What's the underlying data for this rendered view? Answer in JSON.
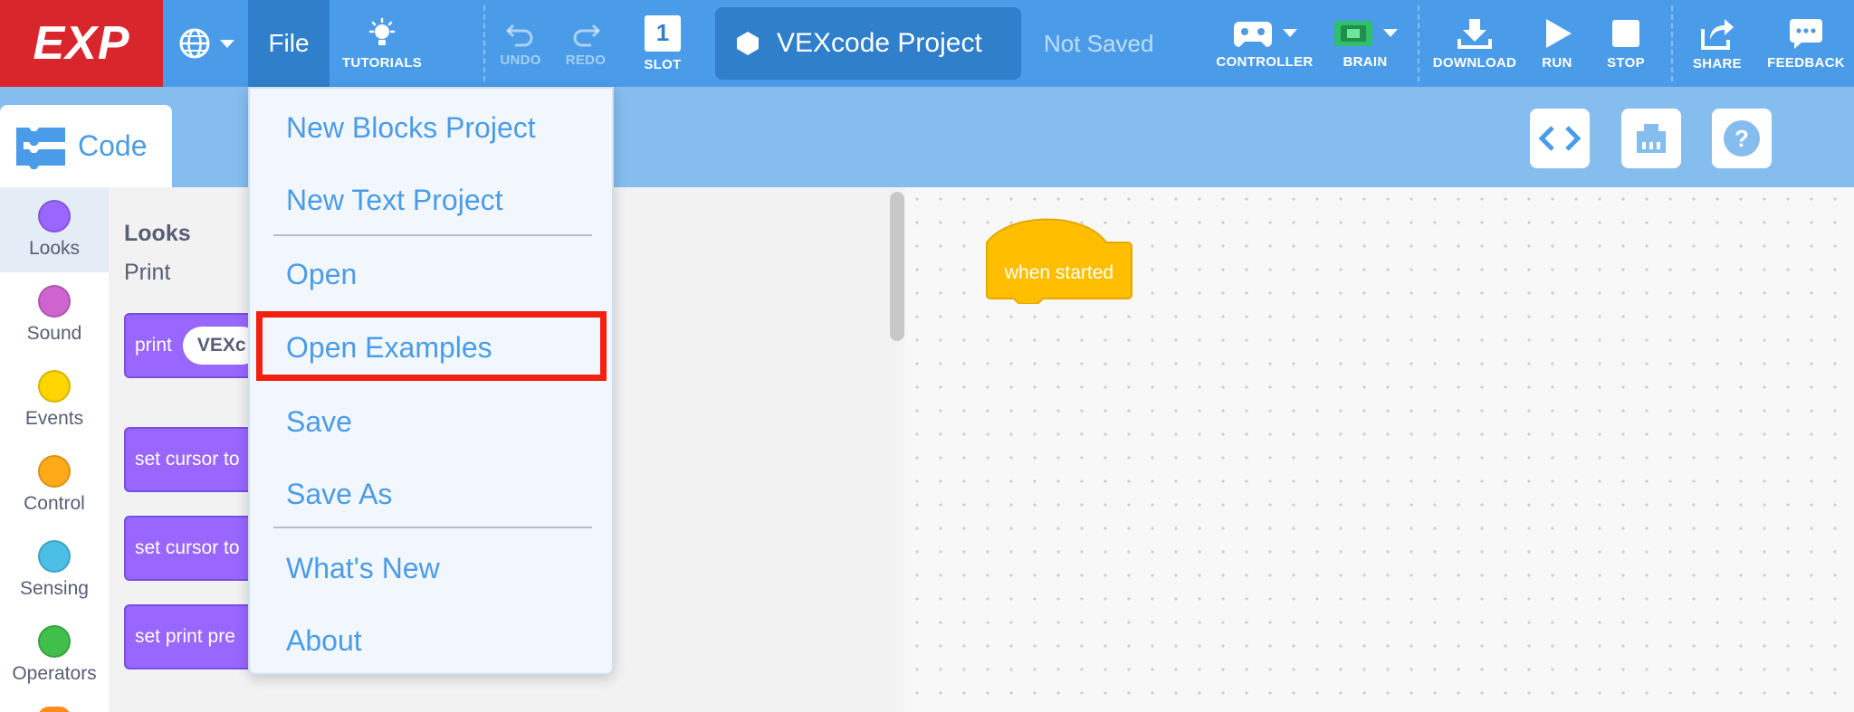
{
  "toolbar": {
    "logo": "EXP",
    "file_label": "File",
    "tutorials_label": "TUTORIALS",
    "undo_label": "UNDO",
    "redo_label": "REDO",
    "slot_label": "SLOT",
    "slot_number": "1",
    "project_name": "VEXcode Project",
    "save_status": "Not Saved",
    "controller_label": "CONTROLLER",
    "brain_label": "BRAIN",
    "download_label": "DOWNLOAD",
    "run_label": "RUN",
    "stop_label": "STOP",
    "share_label": "SHARE",
    "feedback_label": "FEEDBACK"
  },
  "tabs": {
    "code_label": "Code"
  },
  "categories": [
    {
      "label": "Looks",
      "color": "#9966ff"
    },
    {
      "label": "Sound",
      "color": "#cf63cf"
    },
    {
      "label": "Events",
      "color": "#ffd500"
    },
    {
      "label": "Control",
      "color": "#ffab19"
    },
    {
      "label": "Sensing",
      "color": "#4cbfe6"
    },
    {
      "label": "Operators",
      "color": "#40bf4a"
    }
  ],
  "palette": {
    "heading": "Looks",
    "subheading": "Print",
    "blocks": [
      {
        "label": "print",
        "arg": "VEXc"
      },
      {
        "label": "set cursor to"
      },
      {
        "label": "set cursor to"
      },
      {
        "label": "set print pre"
      }
    ]
  },
  "workspace": {
    "hat_block_label": "when started"
  },
  "file_menu": {
    "items": [
      "New Blocks Project",
      "New Text Project",
      "Open",
      "Open Examples",
      "Save",
      "Save As",
      "What's New",
      "About"
    ]
  },
  "colors": {
    "toolbar": "#4a9ce8",
    "logo": "#d9262c",
    "accent": "#4a9ce8",
    "highlight": "#f2200f",
    "hat_block": "#ffbf00"
  }
}
